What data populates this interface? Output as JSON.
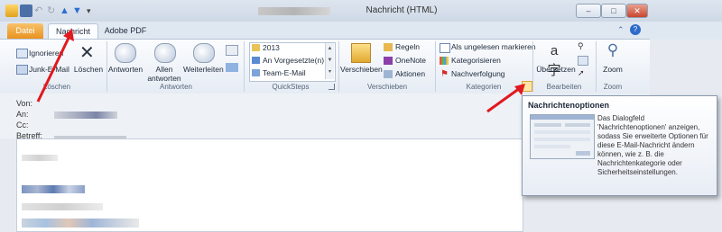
{
  "window": {
    "title": "Nachricht (HTML)",
    "controls": {
      "minimize": "–",
      "maximize": "□",
      "close": "✕"
    }
  },
  "tabs": [
    {
      "label": "Datei"
    },
    {
      "label": "Nachricht"
    },
    {
      "label": "Adobe PDF"
    }
  ],
  "ribbon": {
    "loeschen": {
      "ignore": "Ignorieren",
      "junk": "Junk-E-Mail",
      "delete": "Löschen",
      "group_label": "Löschen"
    },
    "antworten": {
      "reply": "Antworten",
      "reply_all_line1": "Allen",
      "reply_all_line2": "antworten",
      "forward": "Weiterleiten",
      "group_label": "Antworten"
    },
    "quicksteps": {
      "items": [
        "2013",
        "An Vorgesetzte(n)",
        "Team-E-Mail"
      ],
      "group_label": "QuickSteps"
    },
    "verschieben": {
      "move": "Verschieben",
      "rules": "Regeln",
      "onenote": "OneNote",
      "actions": "Aktionen",
      "group_label": "Verschieben"
    },
    "kategorien": {
      "mark_unread": "Als ungelesen markieren",
      "categorize": "Kategorisieren",
      "follow_up": "Nachverfolgung",
      "group_label": "Kategorien"
    },
    "bearbeiten": {
      "translate": "Übersetzen",
      "group_label": "Bearbeiten"
    },
    "zoom": {
      "zoom": "Zoom",
      "group_label": "Zoom"
    }
  },
  "header": {
    "from_label": "Von:",
    "to_label": "An:",
    "cc_label": "Cc:",
    "subject_label": "Betreff:"
  },
  "tooltip": {
    "title": "Nachrichtenoptionen",
    "text": "Das Dialogfeld 'Nachrichtenoptionen' anzeigen, sodass Sie erweiterte Optionen für diese E-Mail-Nachricht ändern können, wie z. B. die Nachrichtenkategorie oder Sicherheitseinstellungen."
  },
  "colors": {
    "accent_orange": "#e8921f",
    "annotation_red": "#e0191e",
    "ribbon_bg": "#eef2f7"
  }
}
